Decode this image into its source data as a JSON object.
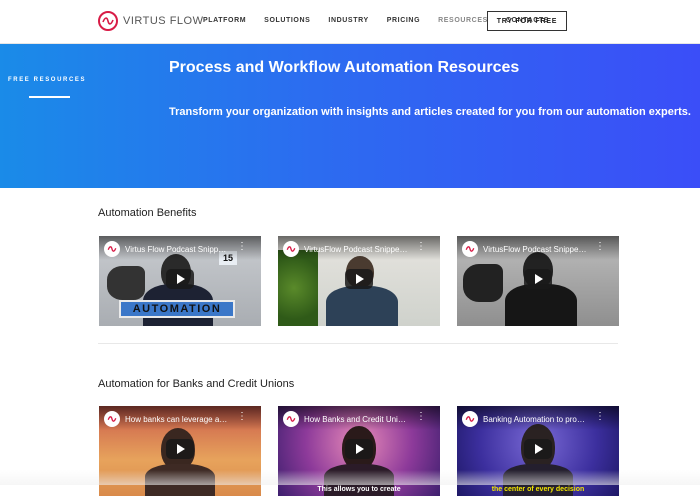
{
  "header": {
    "logo_text": "VIRTUS FLOW",
    "nav": [
      "PLATFORM",
      "SOLUTIONS",
      "INDUSTRY",
      "PRICING",
      "RESOURCES",
      "CONTACTS"
    ],
    "active_nav": "RESOURCES",
    "cta_label": "TRY FOR FREE"
  },
  "hero": {
    "side_label": "FREE RESOURCES",
    "title": "Process and Workflow Automation Resources",
    "subtitle": "Transform your organization with insights and articles created for you from our automation experts."
  },
  "sections": [
    {
      "title": "Automation Benefits",
      "videos": [
        {
          "title": "Virtus Flow Podcast Snipp…",
          "overlay_badge": "15",
          "overlay_banner": "AUTOMATION"
        },
        {
          "title": "VirtusFlow Podcast Snippe…"
        },
        {
          "title": "VirtusFlow Podcast Snippe…"
        }
      ]
    },
    {
      "title": "Automation for Banks and Credit Unions",
      "videos": [
        {
          "title": "How banks can leverage a…"
        },
        {
          "title": "How Banks and Credit Uni…",
          "caption": "This allows you to create"
        },
        {
          "title": "Banking Automation to pro…",
          "caption": "the center of every decision"
        }
      ]
    }
  ],
  "icons": {
    "video_channel": "virtus-flow-logo-icon",
    "play": "play-icon",
    "more": "more-vertical-icon"
  },
  "colors": {
    "brand": "#d81b46",
    "hero_start": "#1a8be8",
    "hero_end": "#3b4ef8",
    "caption_yellow": "#f2e600"
  }
}
